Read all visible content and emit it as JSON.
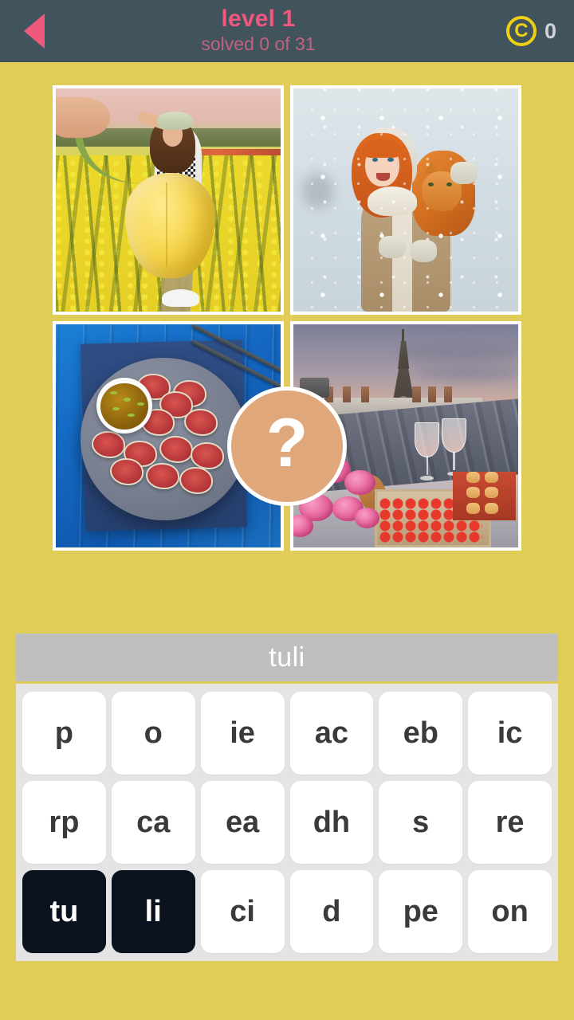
{
  "header": {
    "back_icon": "back-triangle-icon",
    "level_title": "level 1",
    "solved_text": "solved 0 of 31",
    "coin_icon": "coin-icon",
    "coin_symbol": "C",
    "coin_count": "0",
    "bg_color": "#41545e",
    "title_color": "#f1567c",
    "subtitle_color": "#c4617c",
    "coin_color": "#f0d112"
  },
  "page": {
    "background_color": "#dfcd58"
  },
  "puzzle": {
    "hint_badge": {
      "icon": "question-mark-icon",
      "label": "?",
      "color": "#e0a87a"
    },
    "images": [
      {
        "id": "photo-1",
        "alt": "Woman in a yellow tulip field holding a giant tulip like a dress"
      },
      {
        "id": "photo-2",
        "alt": "Red-haired girl holding a ginger cat in falling snow"
      },
      {
        "id": "photo-3",
        "alt": "Seared tuna tataki slices on a grey plate with dipping sauce on blue wood"
      },
      {
        "id": "photo-4",
        "alt": "Paris rooftop picnic with Eiffel Tower, pink peonies, rose wine, strawberries and macarons"
      }
    ]
  },
  "answer": {
    "current": "tuli",
    "bar_color": "#bfbfbf",
    "text_color": "#ffffff"
  },
  "keyboard": {
    "panel_color": "#e4e4e4",
    "tile_color": "#ffffff",
    "tile_used_color": "#0a121f",
    "tiles": [
      {
        "label": "p",
        "used": false
      },
      {
        "label": "o",
        "used": false
      },
      {
        "label": "ie",
        "used": false
      },
      {
        "label": "ac",
        "used": false
      },
      {
        "label": "eb",
        "used": false
      },
      {
        "label": "ic",
        "used": false
      },
      {
        "label": "rp",
        "used": false
      },
      {
        "label": "ca",
        "used": false
      },
      {
        "label": "ea",
        "used": false
      },
      {
        "label": "dh",
        "used": false
      },
      {
        "label": "s",
        "used": false
      },
      {
        "label": "re",
        "used": false
      },
      {
        "label": "tu",
        "used": true
      },
      {
        "label": "li",
        "used": true
      },
      {
        "label": "ci",
        "used": false
      },
      {
        "label": "d",
        "used": false
      },
      {
        "label": "pe",
        "used": false
      },
      {
        "label": "on",
        "used": false
      }
    ]
  }
}
